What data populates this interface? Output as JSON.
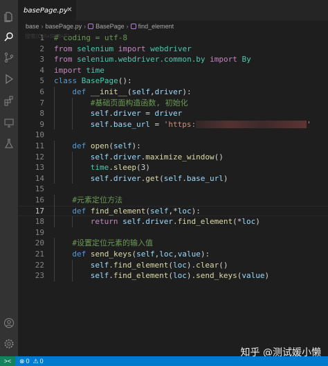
{
  "tab": {
    "label": "basePage.py"
  },
  "breadcrumb": {
    "folder": "base",
    "file": "basePage.py",
    "class": "BasePage",
    "method": "find_element"
  },
  "ghost_text": "搜索(Ctrl+Shift+F)",
  "status": {
    "remote": "><",
    "errors": "0",
    "warnings": "0"
  },
  "watermark": "知乎 @测试媛小懒",
  "code_lines": [
    {
      "n": "1",
      "indent": 0,
      "tokens": [
        {
          "c": "c",
          "t": "# coding = utf-8"
        }
      ]
    },
    {
      "n": "2",
      "indent": 0,
      "tokens": [
        {
          "c": "kc",
          "t": "from "
        },
        {
          "c": "t",
          "t": "selenium"
        },
        {
          "c": "kc",
          "t": " import "
        },
        {
          "c": "t",
          "t": "webdriver"
        }
      ]
    },
    {
      "n": "3",
      "indent": 0,
      "tokens": [
        {
          "c": "kc",
          "t": "from "
        },
        {
          "c": "t",
          "t": "selenium.webdriver.common.by"
        },
        {
          "c": "kc",
          "t": " import "
        },
        {
          "c": "t",
          "t": "By"
        }
      ]
    },
    {
      "n": "4",
      "indent": 0,
      "tokens": [
        {
          "c": "kc",
          "t": "import "
        },
        {
          "c": "t",
          "t": "time"
        }
      ]
    },
    {
      "n": "5",
      "indent": 0,
      "tokens": [
        {
          "c": "k",
          "t": "class "
        },
        {
          "c": "t",
          "t": "BasePage"
        },
        {
          "c": "p",
          "t": "():"
        }
      ]
    },
    {
      "n": "6",
      "indent": 1,
      "tokens": [
        {
          "c": "k",
          "t": "def "
        },
        {
          "c": "f",
          "t": "__init__"
        },
        {
          "c": "p",
          "t": "("
        },
        {
          "c": "v",
          "t": "self"
        },
        {
          "c": "p",
          "t": ","
        },
        {
          "c": "v",
          "t": "driver"
        },
        {
          "c": "p",
          "t": "):"
        }
      ]
    },
    {
      "n": "7",
      "indent": 2,
      "tokens": [
        {
          "c": "c",
          "t": "#基础页面构造函数, 初始化"
        }
      ]
    },
    {
      "n": "8",
      "indent": 2,
      "tokens": [
        {
          "c": "v",
          "t": "self"
        },
        {
          "c": "p",
          "t": "."
        },
        {
          "c": "v",
          "t": "driver"
        },
        {
          "c": "p",
          "t": " = "
        },
        {
          "c": "v",
          "t": "driver"
        }
      ]
    },
    {
      "n": "9",
      "indent": 2,
      "tokens": [
        {
          "c": "v",
          "t": "self"
        },
        {
          "c": "p",
          "t": "."
        },
        {
          "c": "v",
          "t": "base_url"
        },
        {
          "c": "p",
          "t": " = "
        },
        {
          "c": "s",
          "t": "'https:"
        },
        {
          "c": "redact",
          "t": ""
        },
        {
          "c": "s",
          "t": "'"
        }
      ]
    },
    {
      "n": "10",
      "indent": 0,
      "tokens": []
    },
    {
      "n": "11",
      "indent": 1,
      "tokens": [
        {
          "c": "k",
          "t": "def "
        },
        {
          "c": "f",
          "t": "open"
        },
        {
          "c": "p",
          "t": "("
        },
        {
          "c": "v",
          "t": "self"
        },
        {
          "c": "p",
          "t": "):"
        }
      ]
    },
    {
      "n": "12",
      "indent": 2,
      "tokens": [
        {
          "c": "v",
          "t": "self"
        },
        {
          "c": "p",
          "t": "."
        },
        {
          "c": "v",
          "t": "driver"
        },
        {
          "c": "p",
          "t": "."
        },
        {
          "c": "f",
          "t": "maximize_window"
        },
        {
          "c": "p",
          "t": "()"
        }
      ]
    },
    {
      "n": "13",
      "indent": 2,
      "tokens": [
        {
          "c": "t",
          "t": "time"
        },
        {
          "c": "p",
          "t": "."
        },
        {
          "c": "f",
          "t": "sleep"
        },
        {
          "c": "p",
          "t": "(3)"
        }
      ]
    },
    {
      "n": "14",
      "indent": 2,
      "tokens": [
        {
          "c": "v",
          "t": "self"
        },
        {
          "c": "p",
          "t": "."
        },
        {
          "c": "v",
          "t": "driver"
        },
        {
          "c": "p",
          "t": "."
        },
        {
          "c": "f",
          "t": "get"
        },
        {
          "c": "p",
          "t": "("
        },
        {
          "c": "v",
          "t": "self"
        },
        {
          "c": "p",
          "t": "."
        },
        {
          "c": "v",
          "t": "base_url"
        },
        {
          "c": "p",
          "t": ")"
        }
      ]
    },
    {
      "n": "15",
      "indent": 0,
      "tokens": []
    },
    {
      "n": "16",
      "indent": 1,
      "tokens": [
        {
          "c": "c",
          "t": "#元素定位方法"
        }
      ]
    },
    {
      "n": "17",
      "indent": 1,
      "tokens": [
        {
          "c": "k",
          "t": "def "
        },
        {
          "c": "f",
          "t": "find_element"
        },
        {
          "c": "p",
          "t": "("
        },
        {
          "c": "v",
          "t": "self"
        },
        {
          "c": "p",
          "t": ",*"
        },
        {
          "c": "v",
          "t": "loc"
        },
        {
          "c": "p",
          "t": "):"
        }
      ]
    },
    {
      "n": "18",
      "indent": 2,
      "tokens": [
        {
          "c": "kc",
          "t": "return "
        },
        {
          "c": "v",
          "t": "self"
        },
        {
          "c": "p",
          "t": "."
        },
        {
          "c": "v",
          "t": "driver"
        },
        {
          "c": "p",
          "t": "."
        },
        {
          "c": "f",
          "t": "find_element"
        },
        {
          "c": "p",
          "t": "(*"
        },
        {
          "c": "v",
          "t": "loc"
        },
        {
          "c": "p",
          "t": ")"
        }
      ]
    },
    {
      "n": "19",
      "indent": 0,
      "tokens": []
    },
    {
      "n": "20",
      "indent": 1,
      "tokens": [
        {
          "c": "c",
          "t": "#设置定位元素的输入值"
        }
      ]
    },
    {
      "n": "21",
      "indent": 1,
      "tokens": [
        {
          "c": "k",
          "t": "def "
        },
        {
          "c": "f",
          "t": "send_keys"
        },
        {
          "c": "p",
          "t": "("
        },
        {
          "c": "v",
          "t": "self"
        },
        {
          "c": "p",
          "t": ","
        },
        {
          "c": "v",
          "t": "loc"
        },
        {
          "c": "p",
          "t": ","
        },
        {
          "c": "v",
          "t": "value"
        },
        {
          "c": "p",
          "t": "):"
        }
      ]
    },
    {
      "n": "22",
      "indent": 2,
      "tokens": [
        {
          "c": "v",
          "t": "self"
        },
        {
          "c": "p",
          "t": "."
        },
        {
          "c": "f",
          "t": "find_element"
        },
        {
          "c": "p",
          "t": "("
        },
        {
          "c": "v",
          "t": "loc"
        },
        {
          "c": "p",
          "t": ")."
        },
        {
          "c": "f",
          "t": "clear"
        },
        {
          "c": "p",
          "t": "()"
        }
      ]
    },
    {
      "n": "23",
      "indent": 2,
      "tokens": [
        {
          "c": "v",
          "t": "self"
        },
        {
          "c": "p",
          "t": "."
        },
        {
          "c": "f",
          "t": "find_element"
        },
        {
          "c": "p",
          "t": "("
        },
        {
          "c": "v",
          "t": "loc"
        },
        {
          "c": "p",
          "t": ")."
        },
        {
          "c": "f",
          "t": "send_keys"
        },
        {
          "c": "p",
          "t": "("
        },
        {
          "c": "v",
          "t": "value"
        },
        {
          "c": "p",
          "t": ")"
        }
      ]
    }
  ],
  "active_line": "17"
}
